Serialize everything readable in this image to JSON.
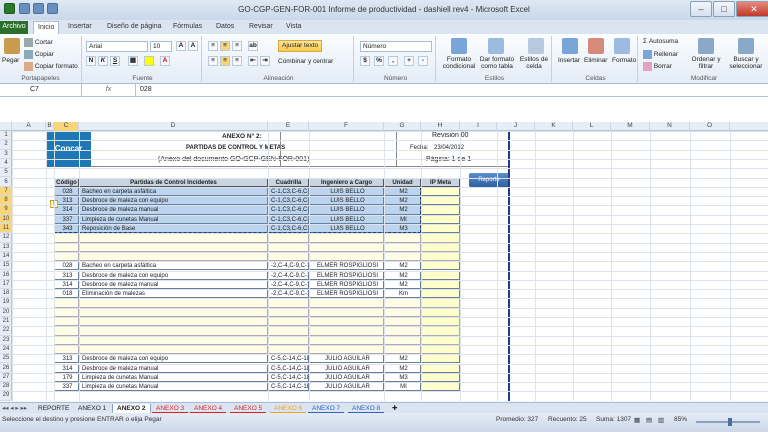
{
  "window": {
    "title": "GO-CGP-GEN-FOR-001 Informe de productividad - dashiell rev4  -  Microsoft Excel",
    "min": "–",
    "max": "□",
    "close": "✕"
  },
  "tabs": [
    "Archivo",
    "Inicio",
    "Insertar",
    "Diseño de página",
    "Fórmulas",
    "Datos",
    "Revisar",
    "Vista"
  ],
  "ribbon": {
    "paste": "Pegar",
    "cut": "Cortar",
    "copy": "Copiar",
    "format_painter": "Copiar formato",
    "clipboard": "Portapapeles",
    "font_name": "Arial",
    "font_size": "10",
    "bold": "N",
    "italic": "K",
    "underline": "S",
    "font": "Fuente",
    "wrap": "Ajustar texto",
    "merge": "Combinar y centrar",
    "alignment": "Alineación",
    "number_format": "Número",
    "number": "Número",
    "cond": "Formato condicional",
    "table": "Dar formato como tabla",
    "cellstyles": "Estilos de celda",
    "styles": "Estilos",
    "insert": "Insertar",
    "delete": "Eliminar",
    "format": "Formato",
    "cells": "Celdas",
    "autosum": "Autosuma",
    "fill": "Rellenar",
    "clear": "Borrar",
    "sort": "Ordenar y filtrar",
    "find": "Buscar y seleccionar",
    "editing": "Modificar"
  },
  "namebox": "C7",
  "fx": "fx",
  "formula_value": "028",
  "columns": [
    "A",
    "B",
    "C",
    "D",
    "E",
    "F",
    "G",
    "H",
    "I",
    "J",
    "K",
    "L",
    "M",
    "N",
    "O"
  ],
  "rows": [
    "1",
    "2",
    "3",
    "4",
    "5",
    "6",
    "7",
    "8",
    "9",
    "10",
    "11",
    "12",
    "13",
    "14",
    "15",
    "16",
    "17",
    "18",
    "19",
    "20",
    "21",
    "22",
    "23",
    "24",
    "25",
    "26",
    "27",
    "28",
    "29"
  ],
  "header": {
    "annex": "ANEXO N° 2:",
    "title": "PARTIDAS DE CONTROL Y METAS",
    "subtitle": "(Anexo del documento GO-GCP-GEN-FOR-001)",
    "revision": "Revisión 00",
    "date_label": "Fecha:",
    "date": "23/04/2012",
    "page": "Página: 1 de 1",
    "concar": "Concar",
    "reporte": "Reporte"
  },
  "table_head": [
    "Código",
    "Partidas de Control Incidentes",
    "Cuadrilla",
    "Ingeniero a Cargo",
    "Unidad",
    "IP Meta"
  ],
  "block1": [
    [
      "028",
      "Bacheo en carpeta asfáltica",
      "C-1,C3,C-6,C-8",
      "LUIS BELLO",
      "M2"
    ],
    [
      "313",
      "Desbroce de maleza con equipo",
      "C-1,C3,C-6,C-8",
      "LUIS BELLO",
      "M2"
    ],
    [
      "314",
      "Desbroce de maleza manual",
      "C-1,C3,C-6,C-8",
      "LUIS BELLO",
      "M2"
    ],
    [
      "337",
      "Limpieza de cunetas Manual",
      "C-1,C3,C-6,C-8",
      "LUIS BELLO",
      "MI"
    ],
    [
      "343",
      "Reposición de Base",
      "C-1,C3,C-6,C-8",
      "LUIS BELLO",
      "M3"
    ]
  ],
  "block2": [
    [
      "028",
      "Bacheo en carpeta asfáltica",
      "-2,C-4,C-9,C-1",
      "ELMER ROSPIGLIOSI",
      "M2"
    ],
    [
      "313",
      "Desbroce de maleza con equipo",
      "-2,C-4,C-9,C-1",
      "ELMER ROSPIGLIOSI",
      "M2"
    ],
    [
      "314",
      "Desbroce de maleza manual",
      "-2,C-4,C-9,C-1",
      "ELMER ROSPIGLIOSI",
      "M2"
    ],
    [
      "018",
      "Eliminación de malezas",
      "-2,C-4,C-9,C-1",
      "ELMER ROSPIGLIOSI",
      "Km"
    ]
  ],
  "block3": [
    [
      "313",
      "Desbroce de maleza con equipo",
      "C-5,C-14,C-18",
      "JULIO AGUILAR",
      "M2"
    ],
    [
      "314",
      "Desbroce de maleza manual",
      "C-5,C-14,C-18",
      "JULIO AGUILAR",
      "M2"
    ],
    [
      "179",
      "Limpieza de cunetas Manual",
      "C-5,C-14,C-18",
      "JULIO AGUILAR",
      "M3"
    ],
    [
      "337",
      "Limpieza de cunetas Manual",
      "C-5,C-14,C-18",
      "JULIO AGUILAR",
      "MI"
    ]
  ],
  "sheets": [
    "REPORTE",
    "ANEXO 1",
    "ANEXO 2",
    "ANEXO 3",
    "ANEXO 4",
    "ANEXO 5",
    "ANEXO 6",
    "ANEXO 7",
    "ANEXO 8"
  ],
  "status": {
    "msg": "Seleccione el destino y presione ENTRAR o elija Pegar",
    "avg": "Promedio: 327",
    "count": "Recuento: 25",
    "sum": "Suma: 1307",
    "zoom": "85%"
  }
}
